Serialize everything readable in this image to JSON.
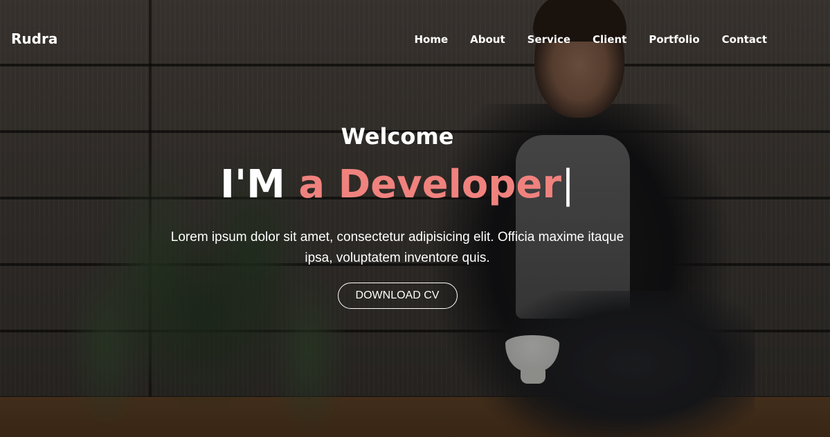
{
  "nav": {
    "brand": "Rudra",
    "links": [
      "Home",
      "About",
      "Service",
      "Client",
      "Portfolio",
      "Contact"
    ]
  },
  "hero": {
    "welcome": "Welcome",
    "headline_prefix": "I'M ",
    "headline_accent": "a Developer",
    "cursor": "|",
    "description": "Lorem ipsum dolor sit amet, consectetur adipisicing elit. Officia maxime itaque ipsa, voluptatem inventore quis.",
    "button_label": "DOWNLOAD CV"
  },
  "colors": {
    "accent": "#f0827e",
    "text": "#ffffff"
  }
}
